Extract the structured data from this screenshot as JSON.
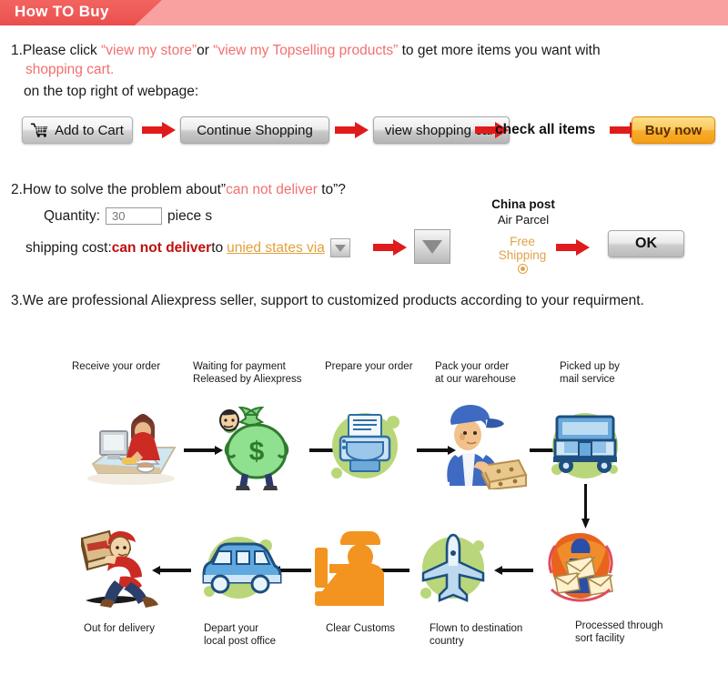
{
  "header": {
    "title": "How TO Buy",
    "ribbon_color": "#ee5a57",
    "bar_color": "#f9a0a0"
  },
  "section1": {
    "prefix": "1.Please click ",
    "q_open_1": "“",
    "link1": "view my store",
    "q_close_1": "”",
    "mid": "or ",
    "q_open_2": "“",
    "link2": "view my Topselling products",
    "q_close_2": "”",
    "tail": " to get more items you want with",
    "line2": "shopping cart.",
    "line3": "on the top right of webpage:",
    "accent_color": "#f2706e"
  },
  "buttons": {
    "add_to_cart": "Add to Cart",
    "continue_shopping": "Continue Shopping",
    "view_shopping_cart": "view shopping cart",
    "check_all_items": "check all items",
    "buy_now": "Buy now",
    "arrow_color": "#e01b1b",
    "buy_now_color": "#f7ae2f"
  },
  "section2": {
    "title_a": "2.How to solve the problem about”",
    "title_red": "can not deliver",
    "title_b": " to”?",
    "quantity_label": "Quantity:",
    "quantity_value": "30",
    "quantity_unit": "piece s",
    "shipping_label": "shipping cost:",
    "shipping_red": "can not deliver",
    "shipping_to": " to ",
    "country": "unied states via",
    "carrier_name": "China post",
    "carrier_service": "Air Parcel",
    "free_shipping_l1": "Free",
    "free_shipping_l2": "Shipping",
    "ok_label": "OK",
    "country_color": "#e0a23c",
    "red_bold_color": "#c10d0d"
  },
  "section3": {
    "title": "3.We are professional Aliexpress seller, support to customized products according to your requirment."
  },
  "flow": {
    "top_labels": [
      "Receive your order",
      "Waiting for payment\nReleased by Aliexpress",
      "Prepare your order",
      "Pack your order\nat our warehouse",
      "Picked up by\nmail service"
    ],
    "bottom_labels": [
      "Out for delivery",
      "Depart your\nlocal post office",
      "Clear Customs",
      "Flown to destination\ncountry",
      "Processed through\nsort facility"
    ],
    "top_icons": [
      "person-at-computer-icon",
      "money-bag-icon",
      "printer-icon",
      "worker-packing-boxes-icon",
      "delivery-truck-icon"
    ],
    "bottom_icons": [
      "running-courier-icon",
      "delivery-van-icon",
      "customs-officer-icon",
      "airplane-icon",
      "mail-sorting-icon"
    ],
    "blob_color": "#b9d77a",
    "arrow_color": "#111111"
  }
}
